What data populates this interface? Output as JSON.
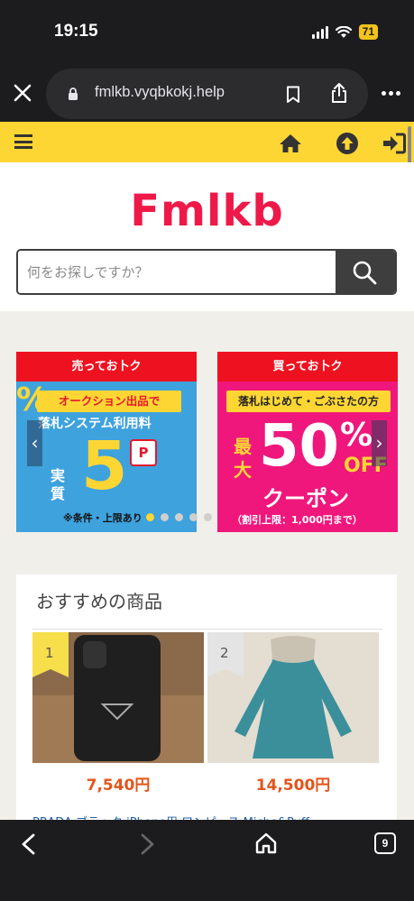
{
  "status": {
    "time": "19:15",
    "battery": "71"
  },
  "browser": {
    "url": "fmlkb.vyqbkokj.help",
    "tab_count": "9"
  },
  "site": {
    "logo": "Fmlkb",
    "search_placeholder": "何をお探しですか？"
  },
  "banners": [
    {
      "header": "売ってお卜ク",
      "ribbon": "オークション出品で",
      "subtitle": "落札システム利用料",
      "vertical": "実質",
      "big": "5",
      "percent": "%",
      "badge": "P",
      "note": "※条件・上限あり"
    },
    {
      "header": "買ってお卜ク",
      "ribbon": "落札はじめて・ごぶさたの方",
      "vertical": "最大",
      "big": "50",
      "percent": "%",
      "off": "OFF",
      "coupon": "クーポン",
      "note": "（割引上限：1,000円まで）"
    }
  ],
  "carousel": {
    "prev_arrow": "‹",
    "next_arrow": "›",
    "dots": 5,
    "active_dot": 0
  },
  "recommend": {
    "title": "おすすめの商品",
    "items": [
      {
        "rank": "1",
        "price": "7,540円",
        "name": "PRADA ブラック iPhone用"
      },
      {
        "rank": "2",
        "price": "14,500円",
        "name": "ワンピース Miche&Puff"
      }
    ],
    "name_line": "PRADA ブラック iPhone用 ワンピース Miche&Puff"
  },
  "colors": {
    "brand_yellow": "#fed634",
    "logo_red": "#ee1948",
    "price_orange": "#e5541b",
    "link_blue": "#1f5faa"
  }
}
